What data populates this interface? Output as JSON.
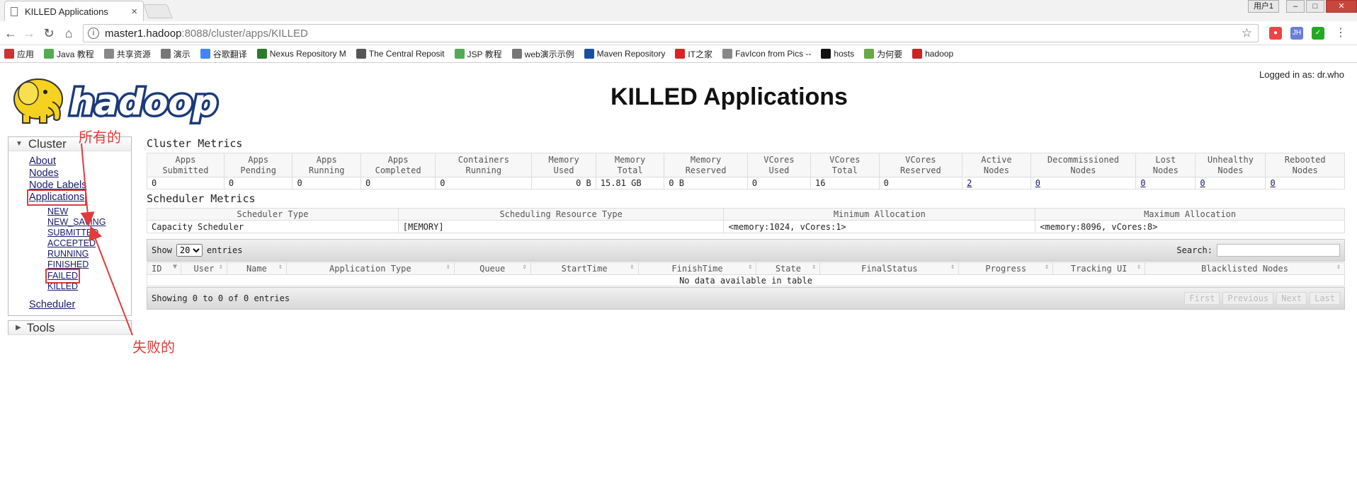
{
  "browser": {
    "tab_title": "KILLED Applications",
    "tab_close": "×",
    "window_user": "用户1",
    "url_host": "master1.hadoop",
    "url_rest": ":8088/cluster/apps/KILLED",
    "bookmarks": [
      {
        "label": "应用",
        "icon": "apps-grid-icon",
        "color": "#c33"
      },
      {
        "label": "Java 教程",
        "icon": "runoob-icon",
        "color": "#5a5"
      },
      {
        "label": "共享资源",
        "icon": "page-icon",
        "color": "#888"
      },
      {
        "label": "演示",
        "icon": "image-icon",
        "color": "#777"
      },
      {
        "label": "谷歌翻译",
        "icon": "google-icon",
        "color": "#4285f4"
      },
      {
        "label": "Nexus Repository M",
        "icon": "nexus-icon",
        "color": "#2d7a2d"
      },
      {
        "label": "The Central Reposit",
        "icon": "list-icon",
        "color": "#555"
      },
      {
        "label": "JSP 教程",
        "icon": "runoob-icon",
        "color": "#5a5"
      },
      {
        "label": "web演示示例",
        "icon": "image-icon",
        "color": "#777"
      },
      {
        "label": "Maven Repository",
        "icon": "mvn-icon",
        "color": "#1a4fa0"
      },
      {
        "label": "IT之家",
        "icon": "ithome-icon",
        "color": "#d22"
      },
      {
        "label": "FavIcon from Pics --",
        "icon": "page-icon",
        "color": "#888"
      },
      {
        "label": "hosts",
        "icon": "github-icon",
        "color": "#111"
      },
      {
        "label": "为何要",
        "icon": "green-icon",
        "color": "#6a4"
      },
      {
        "label": "hadoop",
        "icon": "c-icon",
        "color": "#c22"
      }
    ]
  },
  "header": {
    "logged_in": "Logged in as: dr.who",
    "title": "KILLED Applications"
  },
  "nav": {
    "cluster": "Cluster",
    "about": "About",
    "nodes": "Nodes",
    "node_labels": "Node Labels",
    "applications": "Applications",
    "states": [
      "NEW",
      "NEW_SAVING",
      "SUBMITTED",
      "ACCEPTED",
      "RUNNING",
      "FINISHED",
      "FAILED",
      "KILLED"
    ],
    "scheduler": "Scheduler",
    "tools": "Tools"
  },
  "annotations": {
    "all": "所有的",
    "failed": "失败的",
    "color": "#e23b3b"
  },
  "cluster_metrics": {
    "title": "Cluster Metrics",
    "headers": [
      [
        "Apps",
        "Submitted"
      ],
      [
        "Apps",
        "Pending"
      ],
      [
        "Apps",
        "Running"
      ],
      [
        "Apps",
        "Completed"
      ],
      [
        "Containers",
        "Running"
      ],
      [
        "Memory",
        "Used"
      ],
      [
        "Memory",
        "Total"
      ],
      [
        "Memory",
        "Reserved"
      ],
      [
        "VCores",
        "Used"
      ],
      [
        "VCores",
        "Total"
      ],
      [
        "VCores",
        "Reserved"
      ],
      [
        "Active",
        "Nodes"
      ],
      [
        "Decommissioned",
        "Nodes"
      ],
      [
        "Lost",
        "Nodes"
      ],
      [
        "Unhealthy",
        "Nodes"
      ],
      [
        "Rebooted",
        "Nodes"
      ]
    ],
    "values": [
      "0",
      "0",
      "0",
      "0",
      "0",
      "0 B",
      "15.81 GB",
      "0 B",
      "0",
      "16",
      "0",
      "2",
      "0",
      "0",
      "0",
      "0"
    ]
  },
  "scheduler_metrics": {
    "title": "Scheduler Metrics",
    "headers": [
      "Scheduler Type",
      "Scheduling Resource Type",
      "Minimum Allocation",
      "Maximum Allocation"
    ],
    "values": [
      "Capacity Scheduler",
      "[MEMORY]",
      "<memory:1024, vCores:1>",
      "<memory:8096, vCores:8>"
    ]
  },
  "apps_table": {
    "show": "Show",
    "page_size": "20",
    "entries": "entries",
    "search_label": "Search:",
    "columns": [
      "ID",
      "User",
      "Name",
      "Application Type",
      "Queue",
      "StartTime",
      "FinishTime",
      "State",
      "FinalStatus",
      "Progress",
      "Tracking UI",
      "Blacklisted Nodes"
    ],
    "empty": "No data available in table",
    "info": "Showing 0 to 0 of 0 entries",
    "pager": [
      "First",
      "Previous",
      "Next",
      "Last"
    ]
  }
}
